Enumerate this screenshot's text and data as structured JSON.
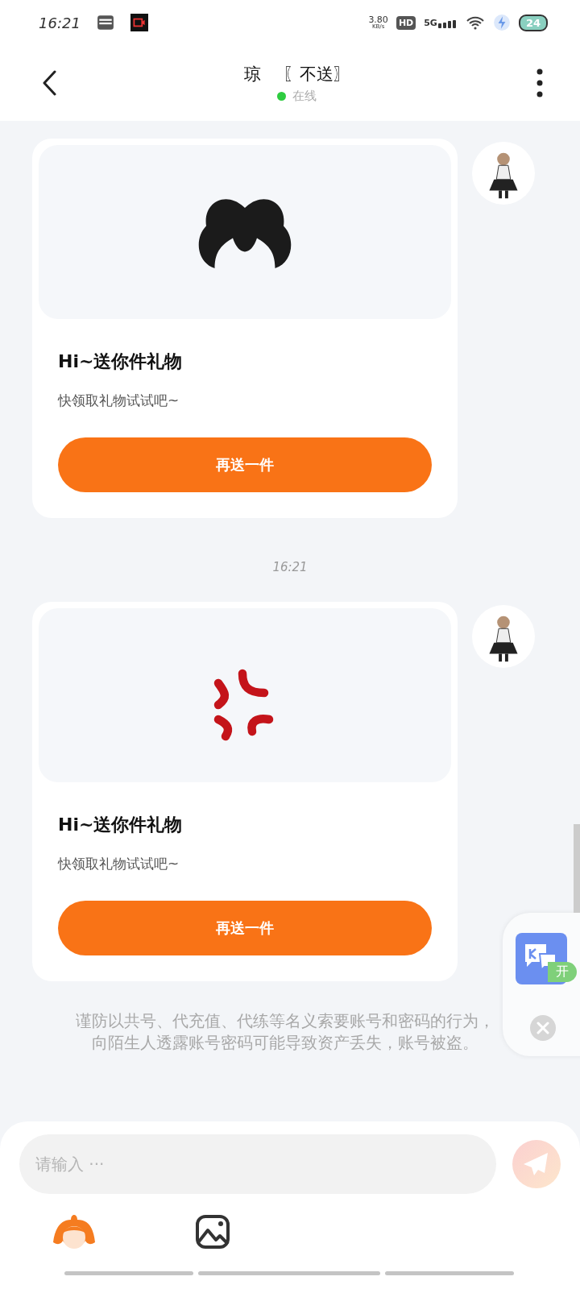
{
  "status_bar": {
    "time": "16:21",
    "speed_value": "3.80",
    "speed_unit": "KB/s",
    "hd": "HD",
    "network": "5G",
    "battery": "24"
  },
  "header": {
    "title": "琼    〖不送〗",
    "status": "在线",
    "online": true
  },
  "messages": [
    {
      "kind": "gift",
      "picture": {
        "kind": "hair"
      },
      "title": "Hi~送你件礼物",
      "subtitle": "快领取礼物试试吧~",
      "button": "再送一件"
    },
    {
      "kind": "time",
      "text": "16:21"
    },
    {
      "kind": "gift",
      "picture": {
        "kind": "anger"
      },
      "title": "Hi~送你件礼物",
      "subtitle": "快领取礼物试试吧~",
      "button": "再送一件"
    }
  ],
  "notice": "谨防以共号、代充值、代练等名义索要账号和密码的行为，向陌生人透露账号密码可能导致资产丢失，账号被盗。",
  "floating_widget": {
    "badge": "开"
  },
  "composer": {
    "placeholder": "请输入 ···"
  }
}
